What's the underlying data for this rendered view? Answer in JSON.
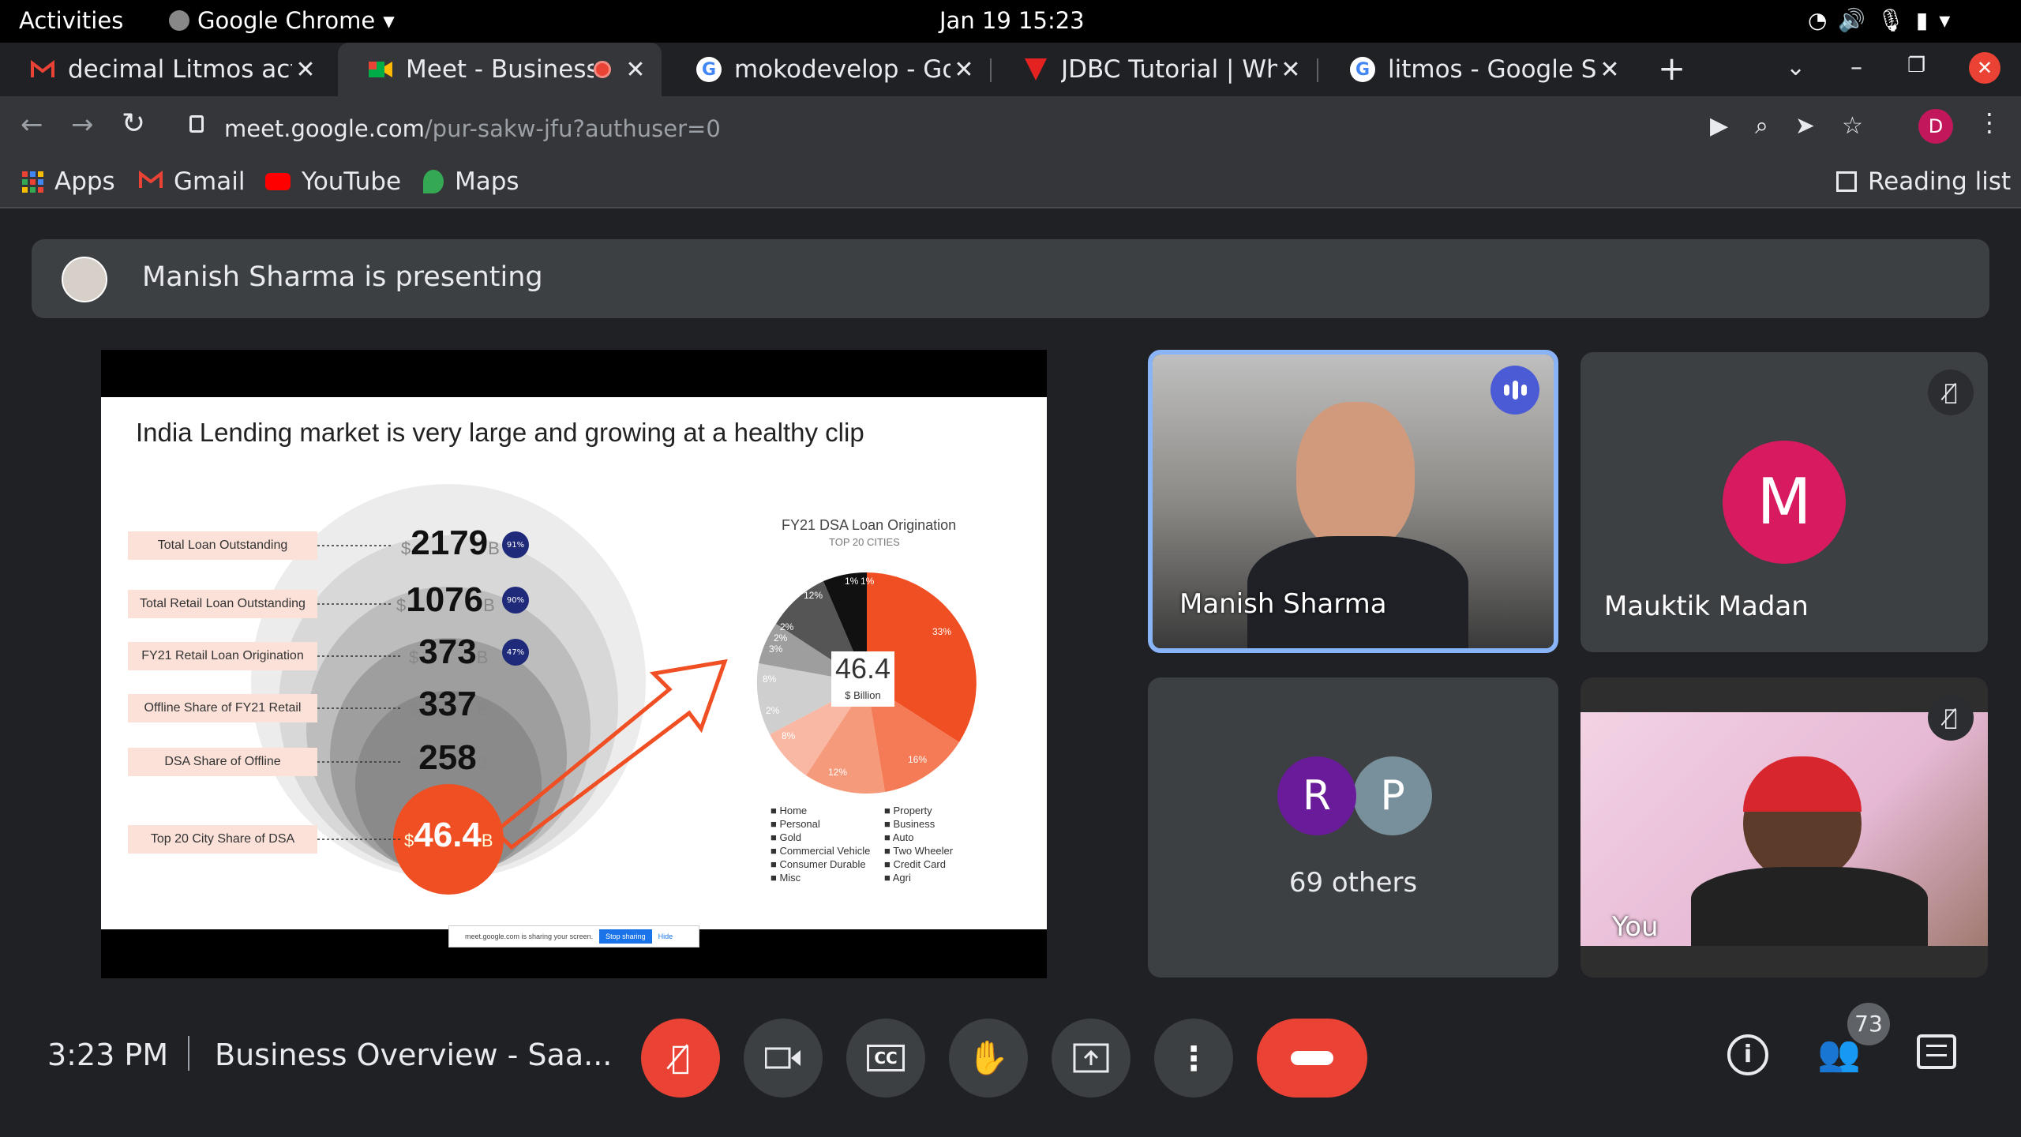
{
  "os_bar": {
    "activities": "Activities",
    "app": "Google Chrome",
    "datetime": "Jan 19  15:23"
  },
  "tabs": [
    {
      "title": "decimal Litmos activ",
      "icon": "gmail-icon"
    },
    {
      "title": "Meet - Business C",
      "icon": "meet-icon"
    },
    {
      "title": "mokodevelop - Goog",
      "icon": "google-icon"
    },
    {
      "title": "JDBC Tutorial | What",
      "icon": "javatpoint-icon"
    },
    {
      "title": "litmos - Google Searc",
      "icon": "google-icon"
    }
  ],
  "url": {
    "host": "meet.google.com",
    "path": "/pur-sakw-jfu?authuser=0"
  },
  "profile_initial": "D",
  "bookmarks": [
    {
      "label": "Apps"
    },
    {
      "label": "Gmail"
    },
    {
      "label": "YouTube"
    },
    {
      "label": "Maps"
    }
  ],
  "reading_list": "Reading list",
  "banner": {
    "text": "Manish Sharma is presenting"
  },
  "slide": {
    "title": "India Lending market is very large and growing at a healthy clip",
    "rows": [
      {
        "label": "Total Loan Outstanding",
        "currency": "$",
        "value": "2179",
        "unit": "B",
        "badge": "91%"
      },
      {
        "label": "Total Retail Loan Outstanding",
        "currency": "$",
        "value": "1076",
        "unit": "B",
        "badge": "90%"
      },
      {
        "label": "FY21 Retail Loan Origination",
        "currency": "$",
        "value": "373",
        "unit": "B",
        "badge": "47%"
      },
      {
        "label": "Offline Share of FY21 Retail",
        "currency": "$",
        "value": "337",
        "unit": "B",
        "badge": ""
      },
      {
        "label": "DSA Share of Offline",
        "currency": "$",
        "value": "258",
        "unit": "B",
        "badge": ""
      },
      {
        "label": "Top 20 City Share of DSA",
        "currency": "$",
        "value": "46.4",
        "unit": "B",
        "badge": ""
      }
    ],
    "pie": {
      "title": "FY21 DSA Loan Origination",
      "subtitle": "TOP 20 CITIES",
      "center_value": "46.4",
      "center_unit": "$ Billion",
      "slice_labels": [
        "33%",
        "16%",
        "12%",
        "8%",
        "2%",
        "8%",
        "3%",
        "2%",
        "2%",
        "12%",
        "1%",
        "1%"
      ],
      "legend_left": [
        "Home",
        "Personal",
        "Gold",
        "Commercial Vehicle",
        "Consumer Durable",
        "Misc"
      ],
      "legend_right": [
        "Property",
        "Business",
        "Auto",
        "Two Wheeler",
        "Credit Card",
        "Agri"
      ]
    },
    "share_bar": {
      "text": "meet.google.com is sharing your screen.",
      "stop": "Stop sharing",
      "hide": "Hide"
    }
  },
  "participants": {
    "presenter": {
      "name": "Manish Sharma"
    },
    "second": {
      "name": "Mauktik Madan",
      "initial": "M"
    },
    "others": {
      "initials": [
        "R",
        "P"
      ],
      "label": "69 others"
    },
    "self": {
      "name": "You"
    }
  },
  "bottom": {
    "time": "3:23 PM",
    "meeting": "Business Overview - Saa...",
    "people_count": "73"
  },
  "colors": {
    "accent_red": "#ea4335",
    "meet_blue": "#8ab4f8",
    "slide_orange": "#f04e23"
  }
}
